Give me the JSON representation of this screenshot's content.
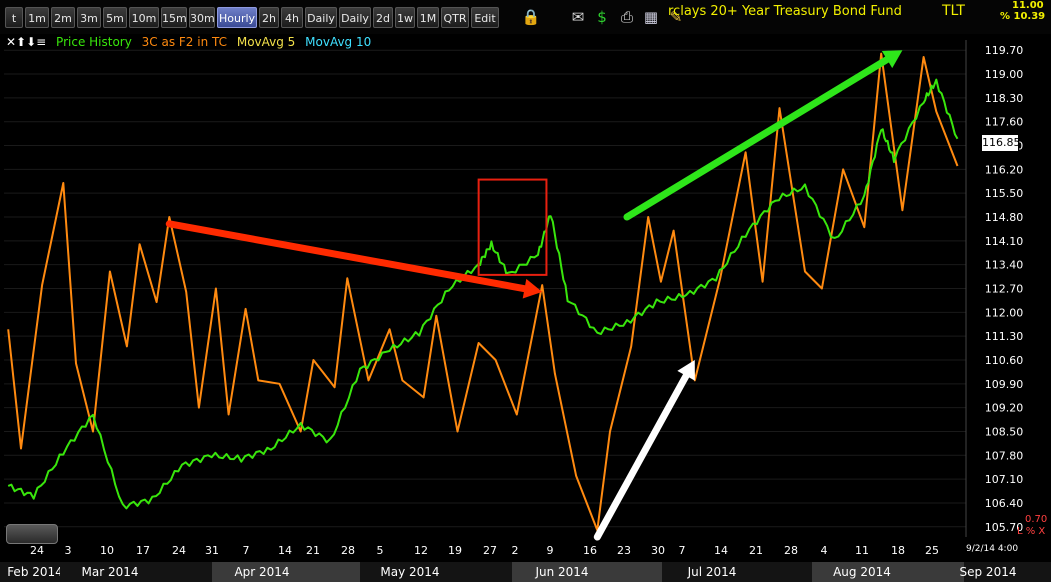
{
  "toolbar": {
    "buttons": [
      "t",
      "1m",
      "2m",
      "3m",
      "5m",
      "10m",
      "15m",
      "30m",
      "Hourly",
      "2h",
      "4h",
      "Daily",
      "Daily",
      "2d",
      "1w",
      "1M",
      "QTR",
      "Edit"
    ],
    "active": "Hourly",
    "icons": [
      "lock-icon",
      "email-icon",
      "dollar-icon",
      "print-icon",
      "calculator-icon",
      "pencil-icon"
    ]
  },
  "header": {
    "title": "rclays 20+ Year Treasury Bond Fund",
    "symbol": "TLT",
    "stat_top": "11.00",
    "stat_pct": "% 10.39"
  },
  "legend": {
    "price": "Price History",
    "osc": "3C as F2 in TC",
    "ma5": "MovAvg 5",
    "ma10": "MovAvg 10",
    "price_color": "#39e60c",
    "osc_color": "#ff8a10",
    "ma5_color": "#f2e04a",
    "ma10_color": "#3fe0ff"
  },
  "right_axis": {
    "labels": [
      "119.70",
      "119.00",
      "118.30",
      "117.60",
      "116.90",
      "116.20",
      "115.50",
      "114.80",
      "114.10",
      "113.40",
      "112.70",
      "112.00",
      "111.30",
      "110.60",
      "109.90",
      "109.20",
      "108.50",
      "107.80",
      "107.10",
      "106.40",
      "105.70"
    ],
    "current_price": "116.85",
    "small_value": "0.70",
    "small_label": "L % X",
    "date_stamp": "9/2/14 4:00"
  },
  "chart_data": {
    "type": "line",
    "series": [
      {
        "name": "Price History",
        "x": [
          "2014-01-21",
          "2014-01-27",
          "2014-02-03",
          "2014-02-10",
          "2014-02-17",
          "2014-02-24",
          "2014-03-03",
          "2014-03-10",
          "2014-03-17",
          "2014-03-24",
          "2014-03-31",
          "2014-04-07",
          "2014-04-14",
          "2014-04-21",
          "2014-04-28",
          "2014-05-05",
          "2014-05-12",
          "2014-05-15",
          "2014-05-19",
          "2014-05-26",
          "2014-05-29",
          "2014-06-02",
          "2014-06-09",
          "2014-06-16",
          "2014-06-23",
          "2014-06-30",
          "2014-07-07",
          "2014-07-14",
          "2014-07-21",
          "2014-07-28",
          "2014-08-04",
          "2014-08-11",
          "2014-08-15",
          "2014-08-18",
          "2014-08-25",
          "2014-08-28",
          "2014-09-02"
        ],
        "y": [
          106.9,
          106.6,
          107.9,
          109.0,
          106.3,
          106.5,
          107.5,
          107.8,
          107.7,
          108.0,
          108.7,
          108.2,
          110.3,
          110.9,
          111.4,
          112.7,
          113.4,
          114.0,
          113.1,
          113.7,
          114.9,
          112.4,
          111.4,
          111.7,
          112.3,
          112.5,
          113.0,
          114.3,
          115.3,
          115.7,
          114.1,
          115.4,
          117.4,
          116.5,
          118.2,
          118.8,
          117.1
        ]
      },
      {
        "name": "3C as F2 in TC",
        "x": [
          "2014-01-21",
          "2014-01-24",
          "2014-01-29",
          "2014-02-03",
          "2014-02-06",
          "2014-02-10",
          "2014-02-14",
          "2014-02-18",
          "2014-02-21",
          "2014-02-25",
          "2014-02-28",
          "2014-03-04",
          "2014-03-07",
          "2014-03-11",
          "2014-03-14",
          "2014-03-18",
          "2014-03-21",
          "2014-03-26",
          "2014-03-31",
          "2014-04-03",
          "2014-04-08",
          "2014-04-11",
          "2014-04-16",
          "2014-04-21",
          "2014-04-24",
          "2014-04-29",
          "2014-05-02",
          "2014-05-07",
          "2014-05-12",
          "2014-05-16",
          "2014-05-21",
          "2014-05-27",
          "2014-05-30",
          "2014-06-04",
          "2014-06-09",
          "2014-06-12",
          "2014-06-17",
          "2014-06-21",
          "2014-06-24",
          "2014-06-27",
          "2014-07-02",
          "2014-07-08",
          "2014-07-14",
          "2014-07-18",
          "2014-07-22",
          "2014-07-28",
          "2014-08-01",
          "2014-08-06",
          "2014-08-11",
          "2014-08-15",
          "2014-08-20",
          "2014-08-25",
          "2014-08-28",
          "2014-09-02"
        ],
        "y": [
          111.5,
          108.0,
          112.8,
          115.8,
          110.5,
          108.5,
          113.2,
          111.0,
          114.0,
          112.3,
          114.8,
          112.6,
          109.2,
          112.7,
          109.0,
          112.1,
          110.0,
          109.9,
          108.5,
          110.6,
          109.8,
          113.0,
          110.0,
          111.5,
          110.0,
          109.5,
          111.9,
          108.5,
          111.1,
          110.6,
          109.0,
          112.8,
          110.2,
          107.2,
          105.6,
          108.5,
          111.0,
          114.8,
          112.9,
          114.4,
          110.0,
          113.0,
          116.7,
          112.9,
          118.0,
          113.2,
          112.7,
          116.2,
          114.5,
          119.6,
          115.0,
          119.5,
          117.9,
          116.3
        ]
      }
    ],
    "ylim": [
      105.4,
      120.0
    ],
    "xlim": [
      "2014-01-20",
      "2014-09-04"
    ],
    "top_tick_labels": [
      "24",
      "3",
      "10",
      "17",
      "24",
      "31",
      "7",
      "14",
      "21",
      "28",
      "5",
      "12",
      "19",
      "27",
      "2",
      "9",
      "16",
      "23",
      "30",
      "7",
      "14",
      "21",
      "28",
      "4",
      "11",
      "18",
      "25"
    ],
    "month_labels": [
      "Feb 2014",
      "Mar 2014",
      "Apr 2014",
      "May 2014",
      "Jun 2014",
      "Jul 2014",
      "Aug 2014",
      "Sep 2014"
    ],
    "annotations": [
      {
        "type": "arrow",
        "color": "#ff2a00",
        "from": [
          "2014-02-28",
          114.6
        ],
        "to": [
          "2014-05-27",
          112.6
        ]
      },
      {
        "type": "arrow",
        "color": "#2ee61a",
        "from": [
          "2014-06-16",
          114.8
        ],
        "to": [
          "2014-08-20",
          119.7
        ]
      },
      {
        "type": "arrow",
        "color": "#ffffff",
        "from": [
          "2014-06-09",
          105.4
        ],
        "to": [
          "2014-07-02",
          110.6
        ]
      },
      {
        "type": "box",
        "color": "#e82010",
        "from": [
          "2014-05-12",
          115.9
        ],
        "to": [
          "2014-05-28",
          113.1
        ]
      }
    ],
    "grid": true
  }
}
